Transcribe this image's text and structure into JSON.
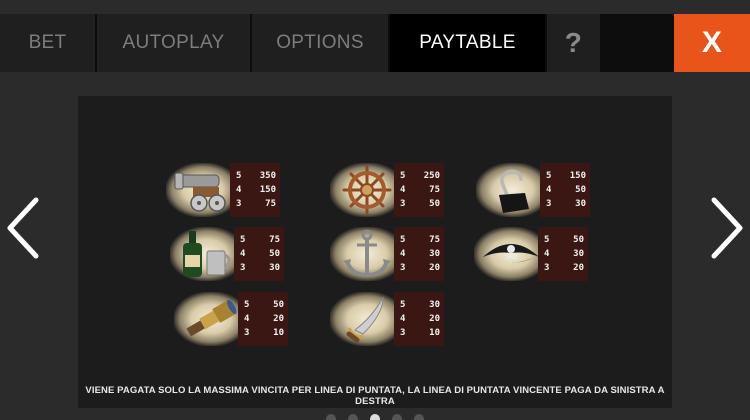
{
  "tabs": {
    "bet": "BET",
    "autoplay": "AUTOPLAY",
    "options": "OPTIONS",
    "paytable": "PAYTABLE",
    "help": "?",
    "close": "X"
  },
  "paytable": {
    "symbols": [
      {
        "icon": "cannon-icon",
        "payouts": [
          {
            "count": "5",
            "value": "350"
          },
          {
            "count": "4",
            "value": "150"
          },
          {
            "count": "3",
            "value": "75"
          }
        ]
      },
      {
        "icon": "ship-wheel-icon",
        "payouts": [
          {
            "count": "5",
            "value": "250"
          },
          {
            "count": "4",
            "value": "75"
          },
          {
            "count": "3",
            "value": "50"
          }
        ]
      },
      {
        "icon": "hook-icon",
        "payouts": [
          {
            "count": "5",
            "value": "150"
          },
          {
            "count": "4",
            "value": "50"
          },
          {
            "count": "3",
            "value": "30"
          }
        ]
      },
      {
        "icon": "rum-bottle-icon",
        "payouts": [
          {
            "count": "5",
            "value": "75"
          },
          {
            "count": "4",
            "value": "50"
          },
          {
            "count": "3",
            "value": "30"
          }
        ]
      },
      {
        "icon": "anchor-icon",
        "payouts": [
          {
            "count": "5",
            "value": "75"
          },
          {
            "count": "4",
            "value": "30"
          },
          {
            "count": "3",
            "value": "20"
          }
        ]
      },
      {
        "icon": "pirate-hat-icon",
        "payouts": [
          {
            "count": "5",
            "value": "50"
          },
          {
            "count": "4",
            "value": "30"
          },
          {
            "count": "3",
            "value": "20"
          }
        ]
      },
      {
        "icon": "spyglass-icon",
        "payouts": [
          {
            "count": "5",
            "value": "50"
          },
          {
            "count": "4",
            "value": "20"
          },
          {
            "count": "3",
            "value": "10"
          }
        ]
      },
      {
        "icon": "cutlass-icon",
        "payouts": [
          {
            "count": "5",
            "value": "30"
          },
          {
            "count": "4",
            "value": "20"
          },
          {
            "count": "3",
            "value": "10"
          }
        ]
      }
    ],
    "note": "VIENE PAGATA SOLO LA MASSIMA VINCITA PER LINEA DI PUNTATA, LA LINEA DI PUNTATA VINCENTE PAGA DA SINISTRA A DESTRA"
  },
  "pagination": {
    "pages": 5,
    "current": 3
  },
  "colors": {
    "accent": "#e8541a",
    "value_bg": "#3a1712",
    "panel": "#1c1c1c"
  }
}
